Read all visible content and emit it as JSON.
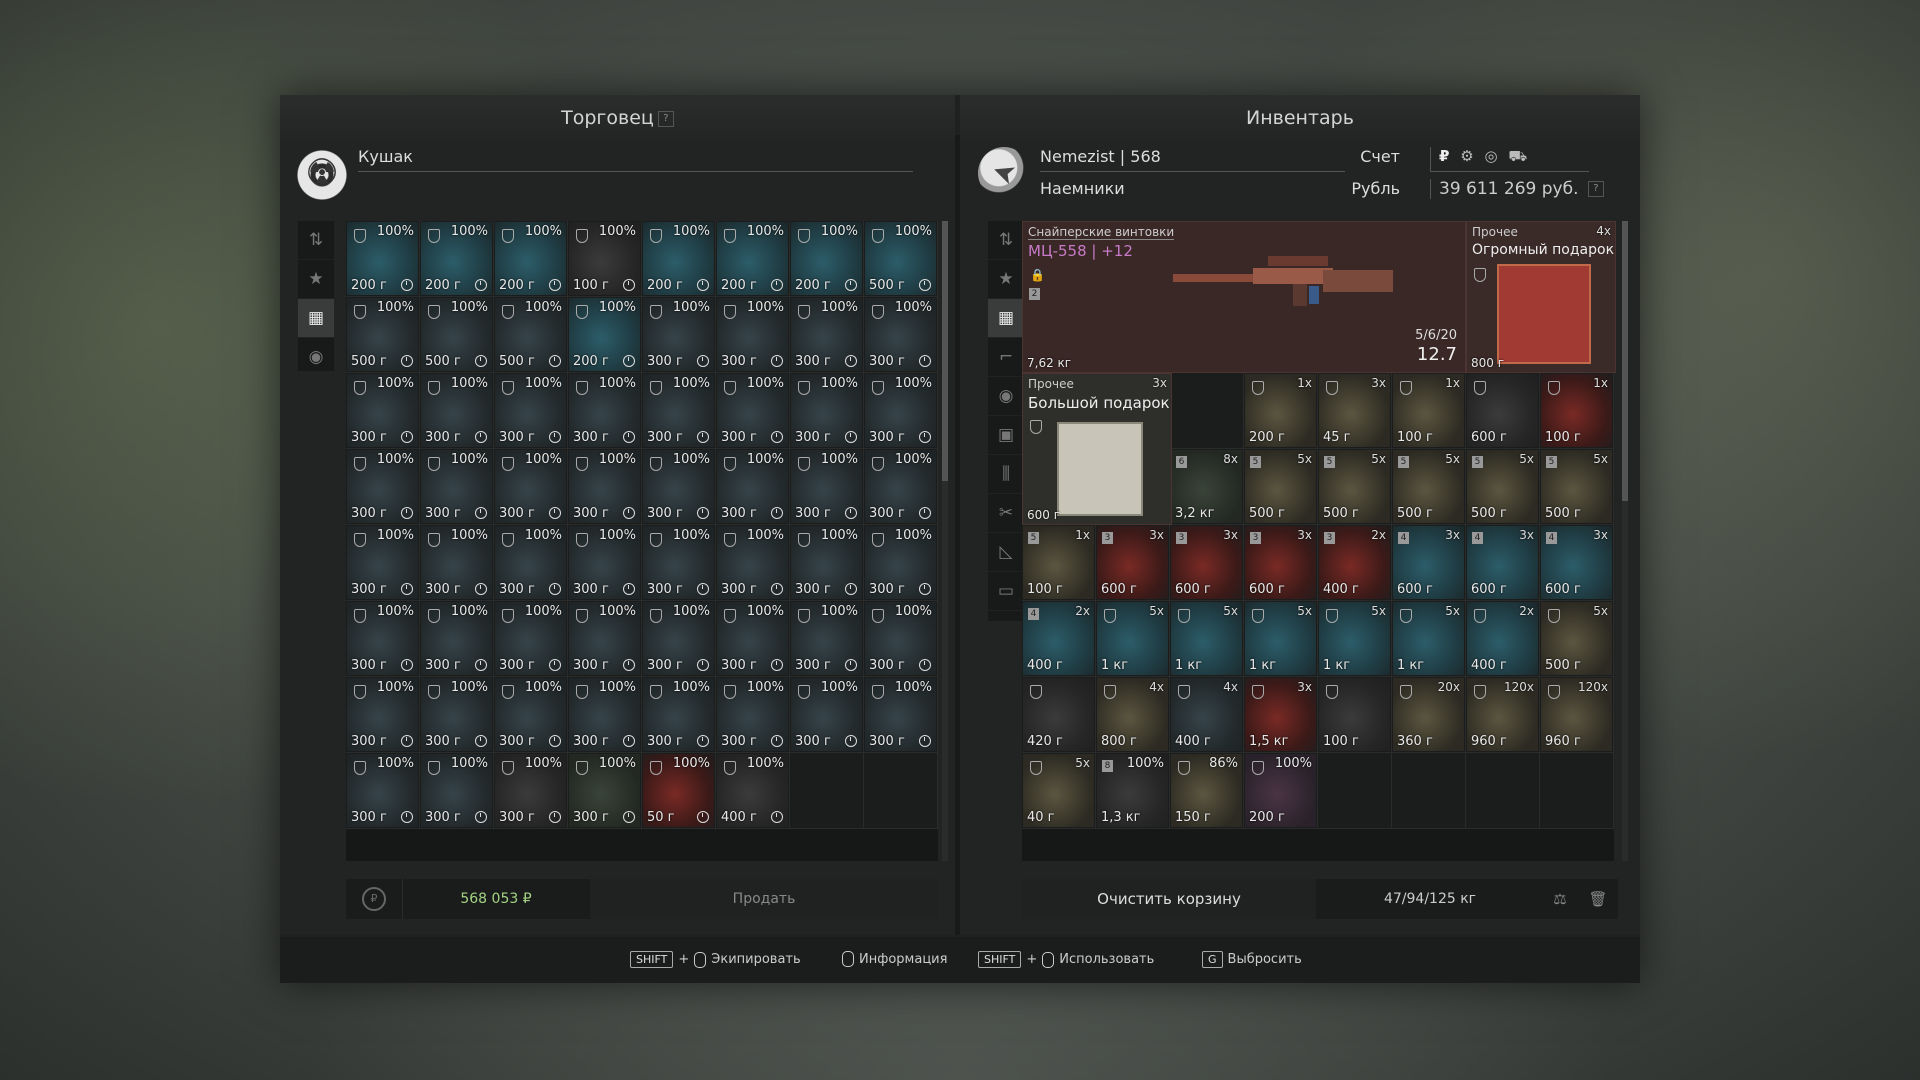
{
  "trader": {
    "title": "Торговец",
    "help": "?",
    "name": "Кушак",
    "sum": "568 053 ₽",
    "sell": "Продать",
    "grid": [
      [
        [
          "100%",
          "200 г",
          "blue"
        ],
        [
          "100%",
          "200 г",
          "blue"
        ],
        [
          "100%",
          "200 г",
          "blue"
        ],
        [
          "100%",
          "100 г",
          "dark"
        ],
        [
          "100%",
          "200 г",
          "blue"
        ],
        [
          "100%",
          "200 г",
          "blue"
        ],
        [
          "100%",
          "200 г",
          "blue"
        ],
        [
          "100%",
          "500 г",
          "blue"
        ]
      ],
      [
        [
          "100%",
          "500 г",
          ""
        ],
        [
          "100%",
          "500 г",
          ""
        ],
        [
          "100%",
          "500 г",
          ""
        ],
        [
          "100%",
          "200 г",
          "blue"
        ],
        [
          "100%",
          "300 г",
          ""
        ],
        [
          "100%",
          "300 г",
          ""
        ],
        [
          "100%",
          "300 г",
          ""
        ],
        [
          "100%",
          "300 г",
          ""
        ]
      ],
      [
        [
          "100%",
          "300 г",
          ""
        ],
        [
          "100%",
          "300 г",
          ""
        ],
        [
          "100%",
          "300 г",
          ""
        ],
        [
          "100%",
          "300 г",
          ""
        ],
        [
          "100%",
          "300 г",
          ""
        ],
        [
          "100%",
          "300 г",
          ""
        ],
        [
          "100%",
          "300 г",
          ""
        ],
        [
          "100%",
          "300 г",
          ""
        ]
      ],
      [
        [
          "100%",
          "300 г",
          ""
        ],
        [
          "100%",
          "300 г",
          ""
        ],
        [
          "100%",
          "300 г",
          ""
        ],
        [
          "100%",
          "300 г",
          ""
        ],
        [
          "100%",
          "300 г",
          ""
        ],
        [
          "100%",
          "300 г",
          ""
        ],
        [
          "100%",
          "300 г",
          ""
        ],
        [
          "100%",
          "300 г",
          ""
        ]
      ],
      [
        [
          "100%",
          "300 г",
          ""
        ],
        [
          "100%",
          "300 г",
          ""
        ],
        [
          "100%",
          "300 г",
          ""
        ],
        [
          "100%",
          "300 г",
          ""
        ],
        [
          "100%",
          "300 г",
          ""
        ],
        [
          "100%",
          "300 г",
          ""
        ],
        [
          "100%",
          "300 г",
          ""
        ],
        [
          "100%",
          "300 г",
          ""
        ]
      ],
      [
        [
          "100%",
          "300 г",
          ""
        ],
        [
          "100%",
          "300 г",
          ""
        ],
        [
          "100%",
          "300 г",
          ""
        ],
        [
          "100%",
          "300 г",
          ""
        ],
        [
          "100%",
          "300 г",
          ""
        ],
        [
          "100%",
          "300 г",
          ""
        ],
        [
          "100%",
          "300 г",
          ""
        ],
        [
          "100%",
          "300 г",
          ""
        ]
      ],
      [
        [
          "100%",
          "300 г",
          ""
        ],
        [
          "100%",
          "300 г",
          ""
        ],
        [
          "100%",
          "300 г",
          ""
        ],
        [
          "100%",
          "300 г",
          ""
        ],
        [
          "100%",
          "300 г",
          ""
        ],
        [
          "100%",
          "300 г",
          ""
        ],
        [
          "100%",
          "300 г",
          ""
        ],
        [
          "100%",
          "300 г",
          ""
        ]
      ],
      [
        [
          "100%",
          "300 г",
          ""
        ],
        [
          "100%",
          "300 г",
          ""
        ],
        [
          "100%",
          "300 г",
          "dark"
        ],
        [
          "100%",
          "300 г",
          "green"
        ],
        [
          "100%",
          "50 г",
          "red"
        ],
        [
          "100%",
          "400 г",
          "dark"
        ],
        null,
        null
      ]
    ]
  },
  "inventory": {
    "title": "Инвентарь",
    "player": "Nemezist | 568",
    "account_label": "Счет",
    "faction": "Наемники",
    "currency_label": "Рубль",
    "currency_icons": [
      "₽",
      "⚙",
      "◎",
      "⛟"
    ],
    "balance": "39 611 269 руб.",
    "help": "?",
    "rifle": {
      "category": "Снайперские винтовки",
      "name": "МЦ-558",
      "upgrade": "+12",
      "ammo": "5/6/20",
      "caliber": "12.7",
      "weight": "7,62 кг",
      "lock": "🔒",
      "level": "2"
    },
    "gift_huge": {
      "category": "Прочее",
      "name": "Огромный подарок",
      "qty": "4x",
      "price": "800 г"
    },
    "gift_big": {
      "category": "Прочее",
      "name": "Большой подарок",
      "qty": "3x",
      "price": "600 г"
    },
    "grid": [
      [
        null,
        null,
        [
          "1x",
          "200 г",
          "tan"
        ],
        [
          "3x",
          "45 г",
          "tan"
        ],
        [
          "1x",
          "100 г",
          "tan"
        ],
        [
          "",
          "600 г",
          "dark"
        ],
        [
          "1x",
          "100 г",
          "red"
        ]
      ],
      [
        null,
        null,
        [
          "8x",
          "3,2 кг",
          "green"
        ],
        [
          "5x",
          "500 г",
          "tan"
        ],
        [
          "5x",
          "500 г",
          "tan"
        ],
        [
          "5x",
          "500 г",
          "tan"
        ],
        [
          "5x",
          "500 г",
          "tan"
        ],
        [
          "5x",
          "500 г",
          "tan"
        ]
      ],
      [
        [
          "1x",
          "100 г",
          "tan"
        ],
        [
          "3x",
          "600 г",
          "red"
        ],
        [
          "3x",
          "600 г",
          "red"
        ],
        [
          "3x",
          "600 г",
          "red"
        ],
        [
          "2x",
          "400 г",
          "red"
        ],
        [
          "3x",
          "600 г",
          "blue"
        ],
        [
          "3x",
          "600 г",
          "blue"
        ],
        [
          "3x",
          "600 г",
          "blue"
        ]
      ],
      [
        [
          "2x",
          "400 г",
          "blue"
        ],
        [
          "5x",
          "1 кг",
          "blue"
        ],
        [
          "5x",
          "1 кг",
          "blue"
        ],
        [
          "5x",
          "1 кг",
          "blue"
        ],
        [
          "5x",
          "1 кг",
          "blue"
        ],
        [
          "5x",
          "1 кг",
          "blue"
        ],
        [
          "2x",
          "400 г",
          "blue"
        ],
        [
          "5x",
          "500 г",
          "tan"
        ]
      ],
      [
        [
          "",
          "420 г",
          "dark"
        ],
        [
          "4x",
          "800 г",
          "tan"
        ],
        [
          "4x",
          "400 г",
          ""
        ],
        [
          "3x",
          "1,5 кг",
          "red"
        ],
        [
          "",
          "100 г",
          "dark"
        ],
        [
          "20x",
          "360 г",
          "tan"
        ],
        [
          "120x",
          "960 г",
          "tan"
        ],
        [
          "120x",
          "960 г",
          "tan"
        ]
      ],
      [
        [
          "5x",
          "40 г",
          "tan"
        ],
        [
          "100%",
          "1,3 кг",
          "dark"
        ],
        [
          "86%",
          "150 г",
          "tan"
        ],
        [
          "100%",
          "200 г",
          "purple"
        ],
        null,
        null,
        null,
        null
      ]
    ],
    "levels": {
      "1": [
        "",
        "",
        "",
        "",
        "",
        "",
        "",
        ""
      ],
      "2": [
        "",
        "",
        "6",
        "5",
        "5",
        "5",
        "5",
        "5"
      ],
      "3": [
        "5",
        "3",
        "3",
        "3",
        "3",
        "4",
        "4",
        "4"
      ],
      "4": [
        "4",
        "",
        "",
        "",
        "",
        "",
        "",
        ""
      ],
      "5": [
        "",
        "",
        "",
        "",
        "",
        "",
        "",
        ""
      ],
      "6": [
        "",
        "8",
        "",
        "",
        "",
        "",
        "",
        ""
      ]
    },
    "clear": "Очистить корзину",
    "weight": "47/94/125 кг"
  },
  "hints": {
    "shift": "SHIFT",
    "plus": "+",
    "equip": "Экипировать",
    "info": "Информация",
    "use": "Использовать",
    "g": "G",
    "drop": "Выбросить"
  }
}
